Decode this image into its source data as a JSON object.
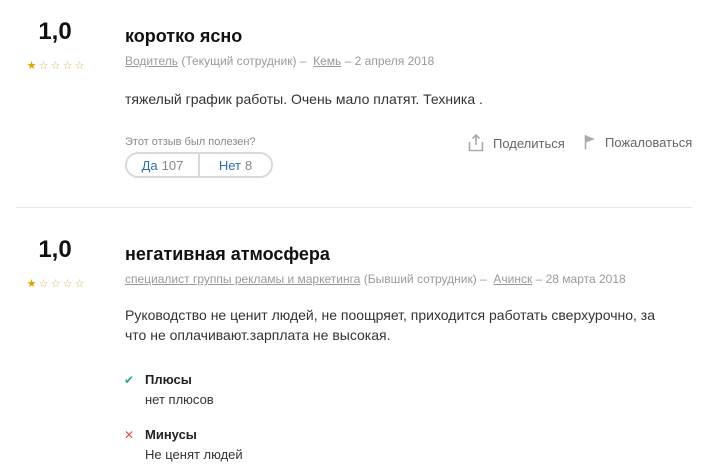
{
  "reviews": [
    {
      "rating": "1,0",
      "stars_filled": 1,
      "stars_total": 5,
      "title": "коротко ясно",
      "position": "Водитель",
      "status": "(Текущий сотрудник) –",
      "city": "Кемь",
      "date": "– 2 апреля 2018",
      "text": "тяжелый график работы. Очень мало платят. Техника .",
      "helpful_label": "Этот отзыв был полезен?",
      "yes_label": "Да",
      "yes_count": "107",
      "no_label": "Нет",
      "no_count": "8",
      "share_label": "Поделиться",
      "report_label": "Пожаловаться"
    },
    {
      "rating": "1,0",
      "stars_filled": 1,
      "stars_total": 5,
      "title": "негативная атмосфера",
      "position": "специалист группы рекламы и маркетинга",
      "status": "(Бывший сотрудник) –",
      "city": "Ачинск",
      "date": "– 28 марта 2018",
      "text": "Руководство не ценит людей, не поощряет, приходится работать сверхурочно, за что не оплачивают.зарплата не высокая.",
      "pros_title": "Плюсы",
      "pros_text": "нет плюсов",
      "cons_title": "Минусы",
      "cons_text": "Не ценят людей"
    }
  ],
  "icons": {
    "star_filled": "star-filled-icon",
    "star_empty": "star-empty-icon",
    "share": "share-icon",
    "flag": "flag-icon",
    "check": "check-icon",
    "cross": "cross-icon"
  },
  "colors": {
    "star": "#e0a100",
    "link": "#2f6eb5",
    "plus": "#2aa87a",
    "minus": "#d9534f"
  }
}
